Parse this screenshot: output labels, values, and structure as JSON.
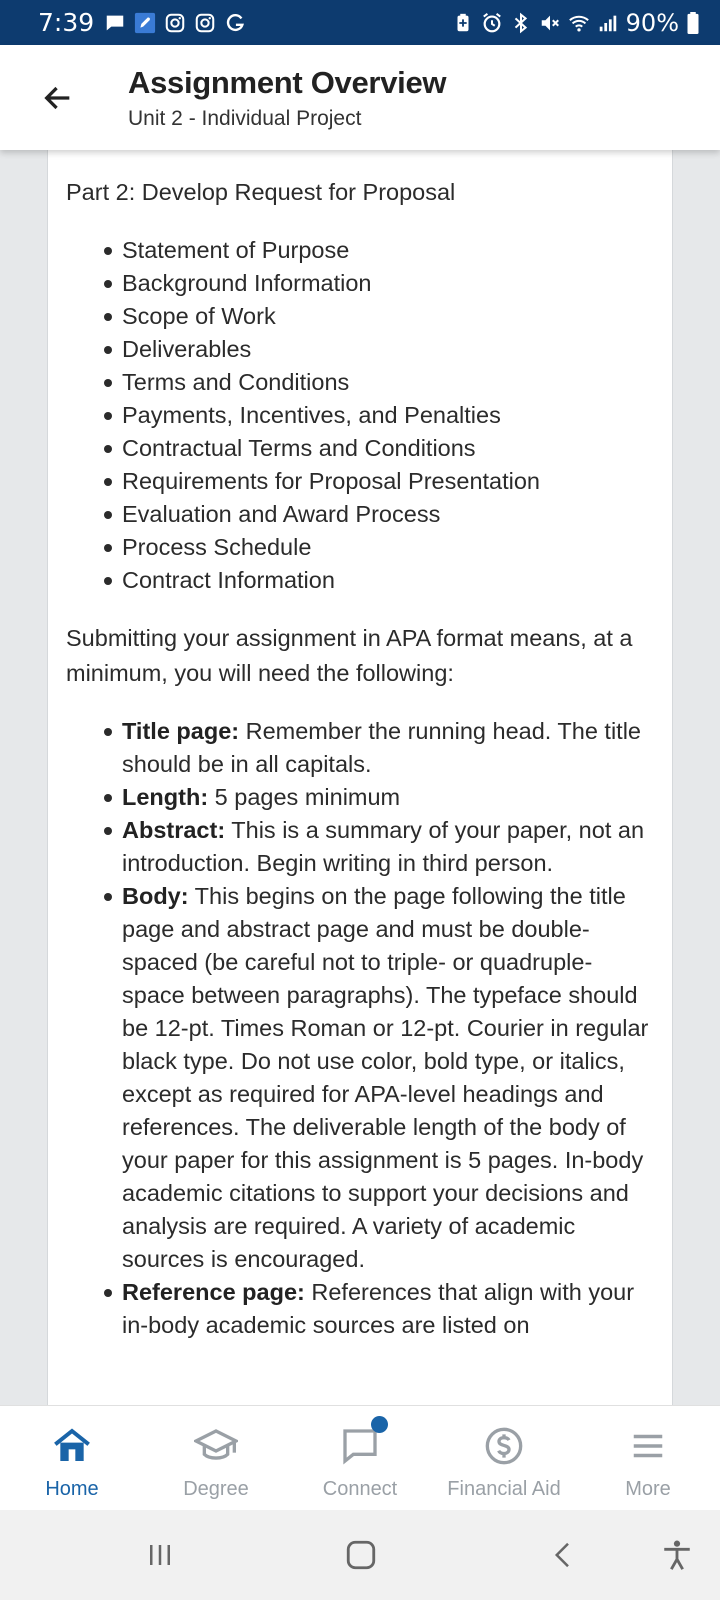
{
  "status_bar": {
    "time": "7:39",
    "battery": "90%",
    "left_icons": [
      "message-icon",
      "rocket-app-icon",
      "instagram-icon",
      "instagram-icon",
      "g-app-icon"
    ],
    "right_icons": [
      "battery-saver-icon",
      "alarm-icon",
      "bluetooth-icon",
      "mute-icon",
      "wifi-icon",
      "signal-icon",
      "battery-icon"
    ]
  },
  "header": {
    "title": "Assignment Overview",
    "subtitle": "Unit 2 - Individual Project"
  },
  "content": {
    "part_heading": "Part 2: Develop Request for Proposal",
    "rfp_items": [
      "Statement of Purpose",
      "Background Information",
      "Scope of Work",
      "Deliverables",
      "Terms and Conditions",
      "Payments, Incentives, and Penalties",
      "Contractual Terms and Conditions",
      "Requirements for Proposal Presentation",
      "Evaluation and Award Process",
      "Process Schedule",
      "Contract Information"
    ],
    "apa_intro": "Submitting your assignment in APA format means, at a minimum, you will need the following:",
    "apa_items": [
      {
        "term": "Title page:",
        "text": " Remember the running head. The title should be in all capitals."
      },
      {
        "term": "Length:",
        "text": " 5 pages minimum"
      },
      {
        "term": "Abstract:",
        "text": " This is a summary of your paper, not an introduction. Begin writing in third person."
      },
      {
        "term": "Body:",
        "text": " This begins on the page following the title page and abstract page and must be double-spaced (be careful not to triple- or quadruple-space between paragraphs). The typeface should be 12-pt. Times Roman or 12-pt. Courier in regular black type. Do not use color, bold type, or italics, except as required for APA-level headings and references. The deliverable length of the body of your paper for this assignment is 5 pages. In-body academic citations to support your decisions and analysis are required. A variety of academic sources is encouraged."
      },
      {
        "term": "Reference page:",
        "text": " References that align with your in-body academic sources are listed on"
      }
    ]
  },
  "bottom_nav": {
    "items": [
      {
        "label": "Home",
        "icon": "home-icon",
        "active": true
      },
      {
        "label": "Degree",
        "icon": "graduation-cap-icon",
        "active": false
      },
      {
        "label": "Connect",
        "icon": "chat-bubble-icon",
        "active": false,
        "notification": true
      },
      {
        "label": "Financial Aid",
        "icon": "dollar-circle-icon",
        "active": false
      },
      {
        "label": "More",
        "icon": "menu-icon",
        "active": false
      }
    ]
  },
  "colors": {
    "status_bar": "#0d3b6f",
    "accent": "#1a64a8",
    "inactive": "#9aa0a6"
  }
}
